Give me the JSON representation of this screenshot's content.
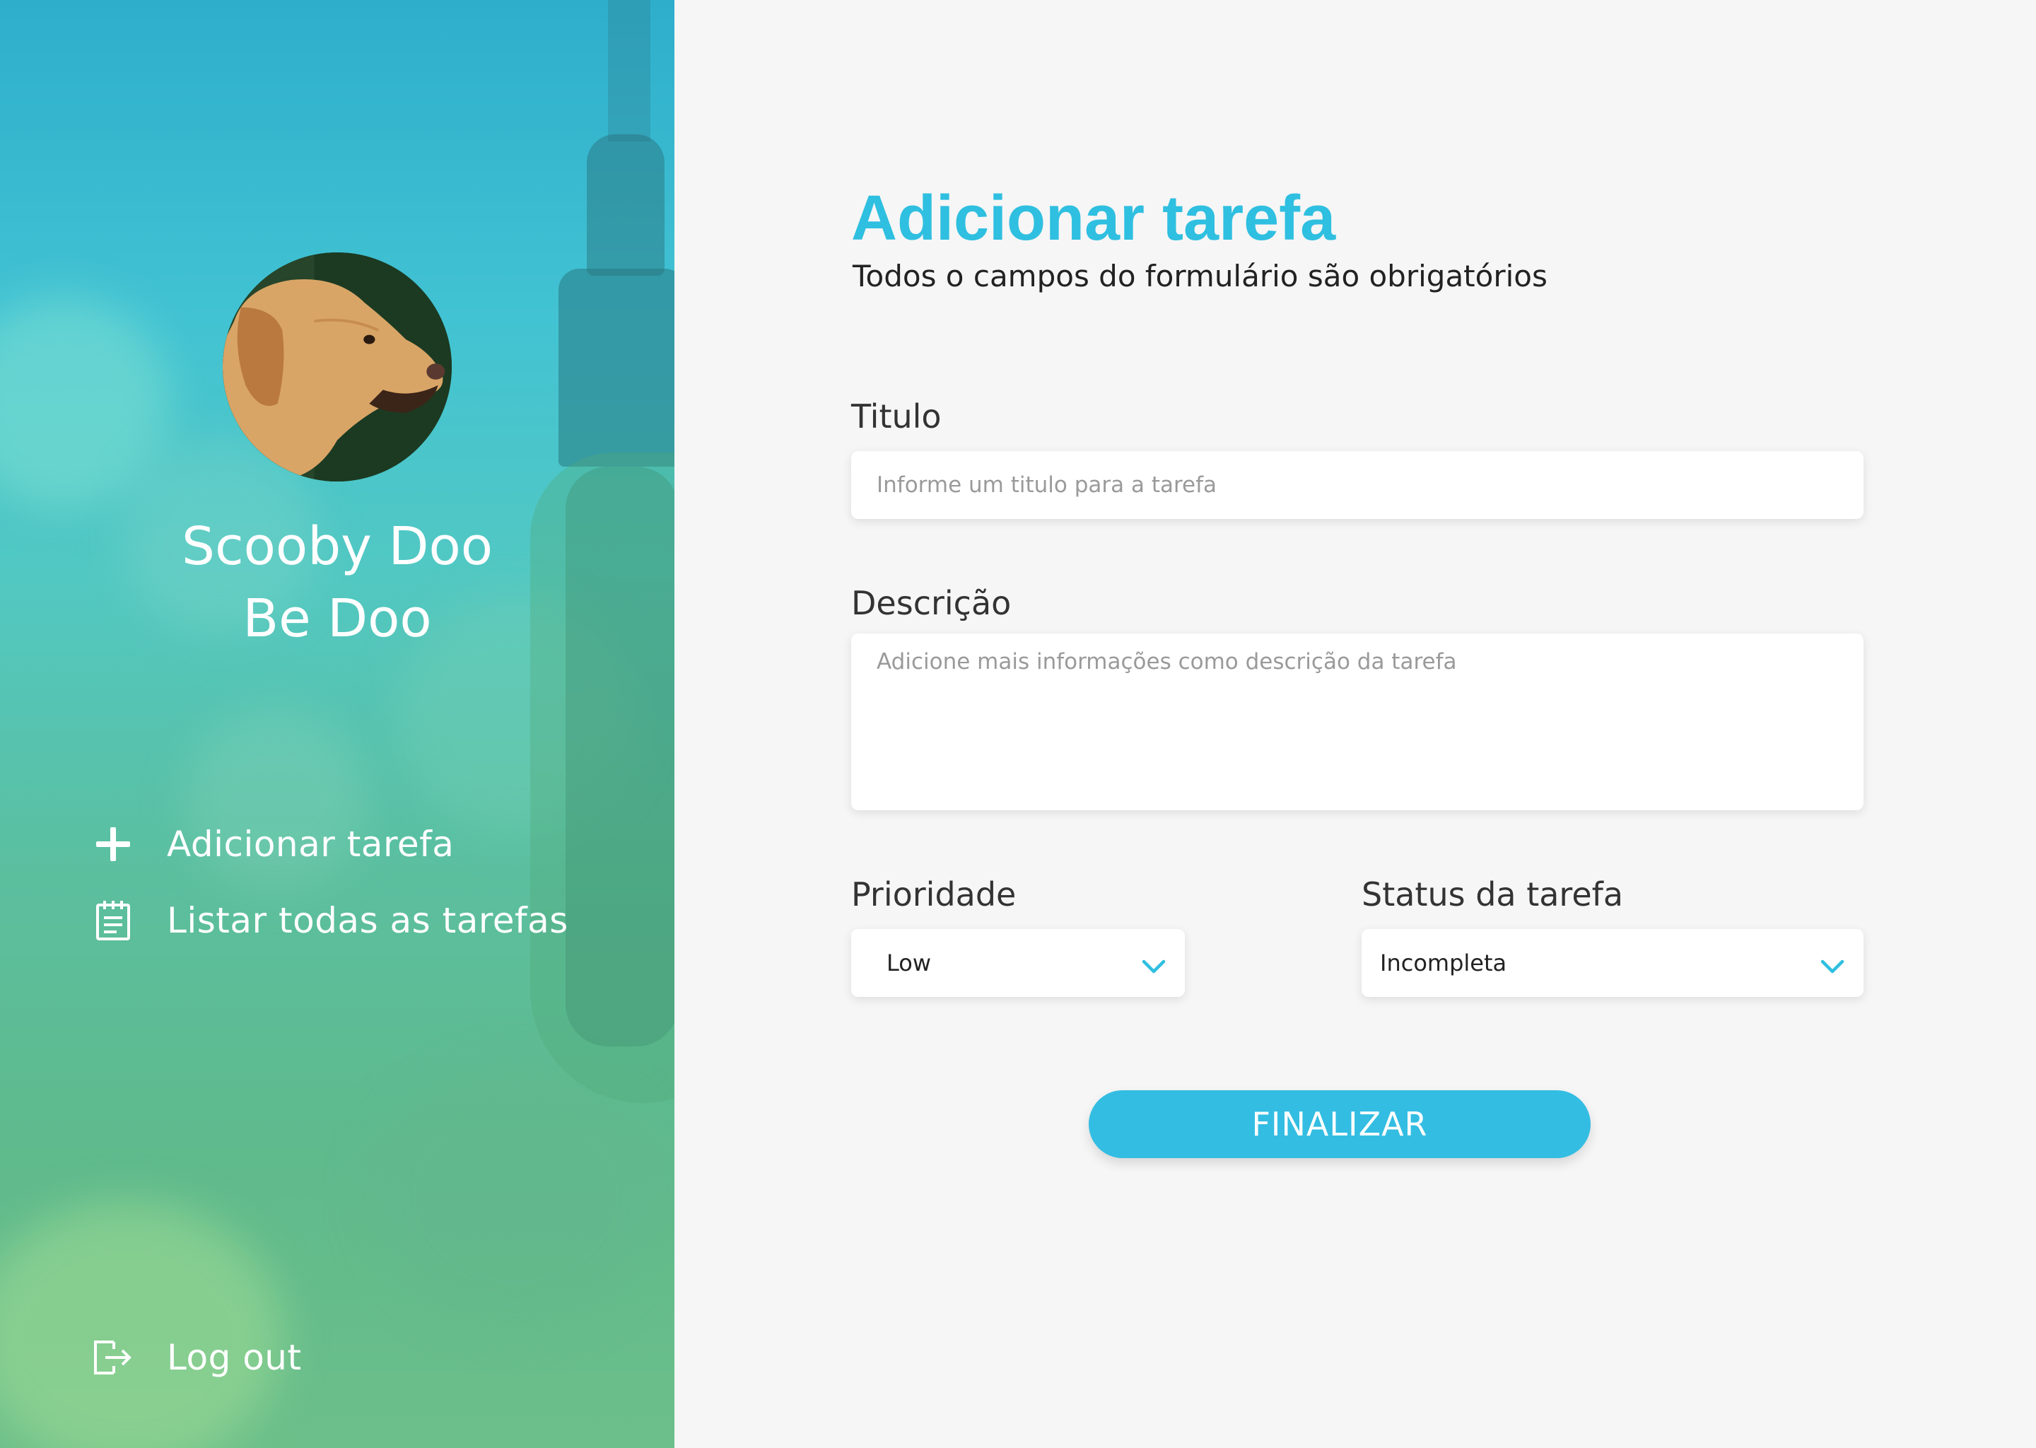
{
  "sidebar": {
    "user_name_line1": "Scooby Doo",
    "user_name_line2": "Be Doo",
    "nav": {
      "add_task": {
        "label": "Adicionar tarefa",
        "icon": "plus-icon"
      },
      "list_tasks": {
        "label": "Listar todas as tarefas",
        "icon": "clipboard-list-icon"
      },
      "logout": {
        "label": "Log out",
        "icon": "logout-icon"
      }
    }
  },
  "main": {
    "title": "Adicionar tarefa",
    "subtitle": "Todos o campos do formulário são obrigatórios",
    "fields": {
      "title": {
        "label": "Titulo",
        "placeholder": "Informe um titulo para a tarefa",
        "value": ""
      },
      "description": {
        "label": "Descrição",
        "placeholder": "Adicione mais informações como descrição da tarefa",
        "value": ""
      },
      "priority": {
        "label": "Prioridade",
        "selected": "Low",
        "icon": "chevron-down-icon"
      },
      "status": {
        "label": "Status da tarefa",
        "selected": "Incompleta",
        "icon": "chevron-down-icon"
      }
    },
    "submit_label": "FINALIZAR"
  },
  "colors": {
    "accent": "#2fbfe0",
    "button": "#33bde2",
    "background": "#f6f6f6",
    "sidebar_top": "#2eaecb",
    "sidebar_bottom": "#6cbf8a"
  }
}
